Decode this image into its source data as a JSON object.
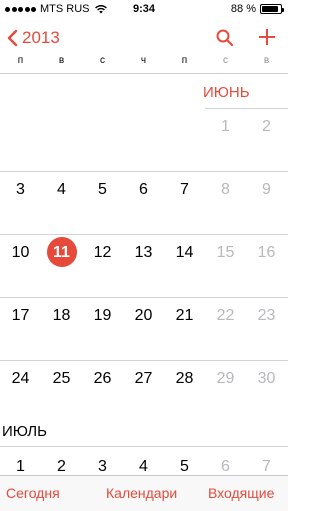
{
  "status_bar": {
    "carrier": "MTS RUS",
    "time": "9:34",
    "battery_text": "88 %",
    "battery_level": 0.88
  },
  "nav": {
    "back_label": "2013",
    "back_icon": "chevron-left-icon",
    "search_icon": "search-icon",
    "add_icon": "plus-icon",
    "accent_color": "#e64a3b"
  },
  "weekdays": [
    "п",
    "в",
    "с",
    "ч",
    "п",
    "с",
    "в"
  ],
  "june": {
    "label": "ИЮНЬ",
    "rows": [
      [
        "",
        "",
        "",
        "",
        "",
        "1",
        "2"
      ],
      [
        "3",
        "4",
        "5",
        "6",
        "7",
        "8",
        "9"
      ],
      [
        "10",
        "11",
        "12",
        "13",
        "14",
        "15",
        "16"
      ],
      [
        "17",
        "18",
        "19",
        "20",
        "21",
        "22",
        "23"
      ],
      [
        "24",
        "25",
        "26",
        "27",
        "28",
        "29",
        "30"
      ]
    ],
    "today": "11"
  },
  "july": {
    "label": "ИЮЛЬ",
    "rows": [
      [
        "1",
        "2",
        "3",
        "4",
        "5",
        "6",
        "7"
      ]
    ]
  },
  "toolbar": {
    "today_label": "Сегодня",
    "calendars_label": "Календари",
    "inbox_label": "Входящие"
  }
}
